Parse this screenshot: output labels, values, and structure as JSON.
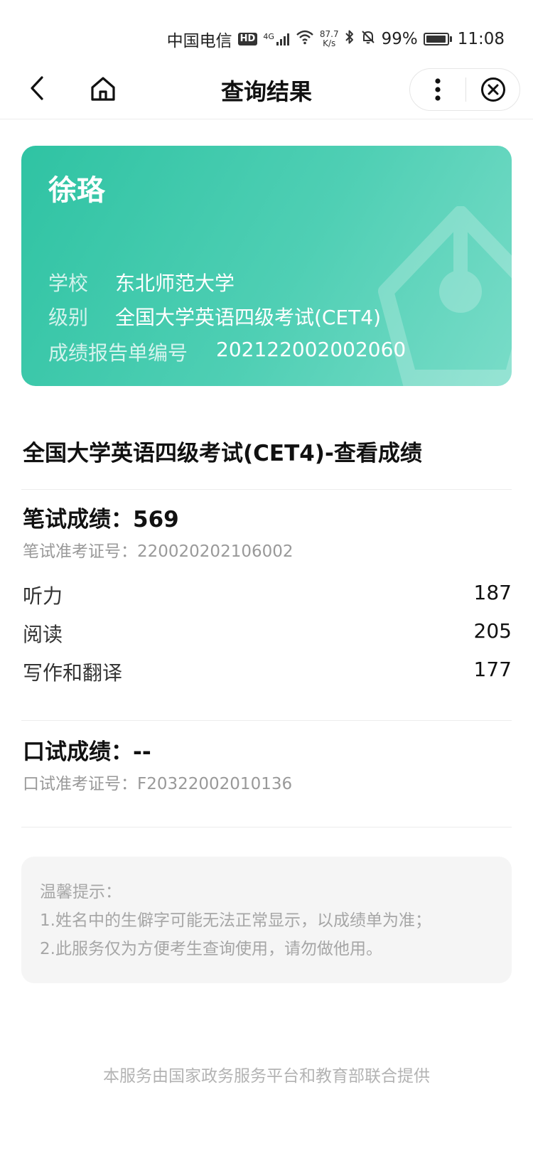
{
  "status_bar": {
    "carrier": "中国电信",
    "hd": "HD",
    "network": "4G",
    "speed_value": "87.7",
    "speed_unit": "K/s",
    "battery": "99%",
    "battery_level": 0.99,
    "time": "11:08"
  },
  "nav": {
    "title": "查询结果",
    "icons": [
      "chevron-left-icon",
      "home-icon",
      "more-dots-icon",
      "close-circle-icon"
    ]
  },
  "card": {
    "name": "徐珞",
    "school_label": "学校",
    "school_value": "东北师范大学",
    "level_label": "级别",
    "level_value": "全国大学英语四级考试(CET4)",
    "report_label": "成绩报告单编号",
    "report_value": "202122002002060",
    "accent_color": "#3fc8aa"
  },
  "result": {
    "exam_title": "全国大学英语四级考试(CET4)-查看成绩",
    "written": {
      "heading": "笔试成绩：569",
      "ticket": "笔试准考证号：220020202106002",
      "items": [
        {
          "label": "听力",
          "score": "187"
        },
        {
          "label": "阅读",
          "score": "205"
        },
        {
          "label": "写作和翻译",
          "score": "177"
        }
      ]
    },
    "oral": {
      "heading": "口试成绩：--",
      "ticket": "口试准考证号：F20322002010136"
    }
  },
  "tips": {
    "title": "温馨提示：",
    "line1": "1.姓名中的生僻字可能无法正常显示，以成绩单为准；",
    "line2": "2.此服务仅为方便考生查询使用，请勿做他用。"
  },
  "footer": "本服务由国家政务服务平台和教育部联合提供"
}
